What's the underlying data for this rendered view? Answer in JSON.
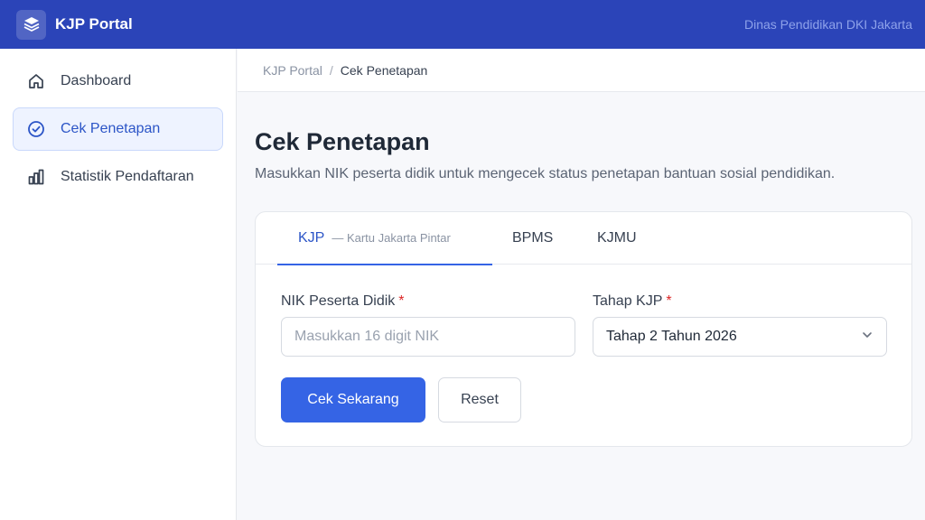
{
  "header": {
    "brand_title": "KJP Portal",
    "logo_icon": "layers-icon",
    "organization": "Dinas Pendidikan DKI Jakarta",
    "background_color": "#2b44b8"
  },
  "sidebar": {
    "items": [
      {
        "label": "Dashboard",
        "icon": "home-icon",
        "active": false
      },
      {
        "label": "Cek Penetapan",
        "icon": "check-circle-icon",
        "active": true
      },
      {
        "label": "Statistik Pendaftaran",
        "icon": "bar-chart-icon",
        "active": false
      }
    ]
  },
  "breadcrumb": {
    "root": "KJP Portal",
    "separator": "/",
    "current": "Cek Penetapan"
  },
  "page": {
    "title": "Cek Penetapan",
    "description": "Masukkan NIK peserta didik untuk mengecek status penetapan bantuan sosial pendidikan."
  },
  "tabs": [
    {
      "label": "KJP",
      "sublabel": "— Kartu Jakarta Pintar",
      "active": true
    },
    {
      "label": "BPMS",
      "active": false
    },
    {
      "label": "KJMU",
      "active": false
    }
  ],
  "form": {
    "nik": {
      "label": "NIK Peserta Didik",
      "required_mark": "*",
      "placeholder": "Masukkan 16 digit NIK",
      "value": ""
    },
    "tahap": {
      "label": "Tahap KJP",
      "required_mark": "*",
      "selected": "Tahap 2 Tahun 2026"
    },
    "submit_label": "Cek Sekarang",
    "reset_label": "Reset"
  },
  "colors": {
    "accent": "#3564e5",
    "active_nav_bg": "#eef3ff",
    "required": "#dc2626"
  }
}
